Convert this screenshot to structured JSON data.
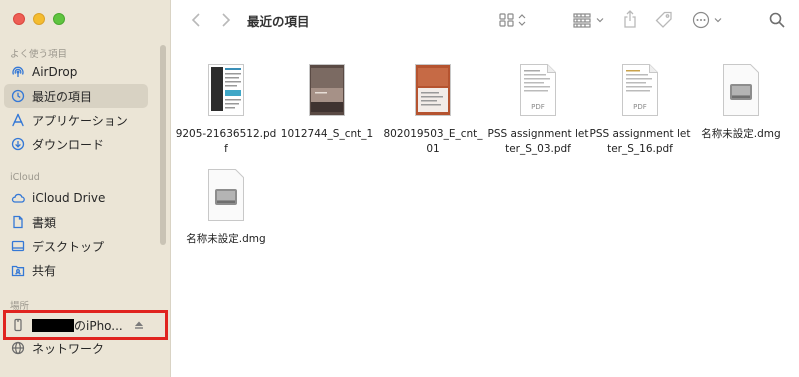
{
  "sidebar": {
    "favorites_header": "よく使う項目",
    "favorites": [
      {
        "label": "AirDrop",
        "icon": "airdrop-icon"
      },
      {
        "label": "最近の項目",
        "icon": "clock-icon",
        "selected": true
      },
      {
        "label": "アプリケーション",
        "icon": "applications-icon"
      },
      {
        "label": "ダウンロード",
        "icon": "download-icon"
      }
    ],
    "icloud_header": "iCloud",
    "icloud": [
      {
        "label": "iCloud Drive",
        "icon": "cloud-icon"
      },
      {
        "label": "書類",
        "icon": "document-icon"
      },
      {
        "label": "デスクトップ",
        "icon": "desktop-icon"
      },
      {
        "label": "共有",
        "icon": "shared-folder-icon"
      }
    ],
    "locations_header": "場所",
    "device_label": "のiPho...",
    "network_label": "ネットワーク"
  },
  "toolbar": {
    "title": "最近の項目",
    "icons": [
      "back-icon",
      "forward-icon",
      "grid-view-icon",
      "group-icon",
      "share-icon",
      "tag-icon",
      "more-icon",
      "search-icon"
    ]
  },
  "files": [
    {
      "name": "9205-21636512.pdf",
      "kind": "doc-color"
    },
    {
      "name": "1012744_S_cnt_1",
      "kind": "brown"
    },
    {
      "name": "802019503_E_cnt_01",
      "kind": "red"
    },
    {
      "name": "PSS assignment letter_S_03.pdf",
      "kind": "pdf",
      "badge": "PDF"
    },
    {
      "name": "PSS assignment letter_S_16.pdf",
      "kind": "pdf",
      "badge": "PDF"
    },
    {
      "name": "名称未設定.dmg",
      "kind": "dmg"
    },
    {
      "name": "名称未設定.dmg",
      "kind": "dmg"
    }
  ],
  "colors": {
    "sidebar_bg": "#ebe5d6",
    "accent": "#3478d6",
    "highlight_box": "#e0241f"
  }
}
